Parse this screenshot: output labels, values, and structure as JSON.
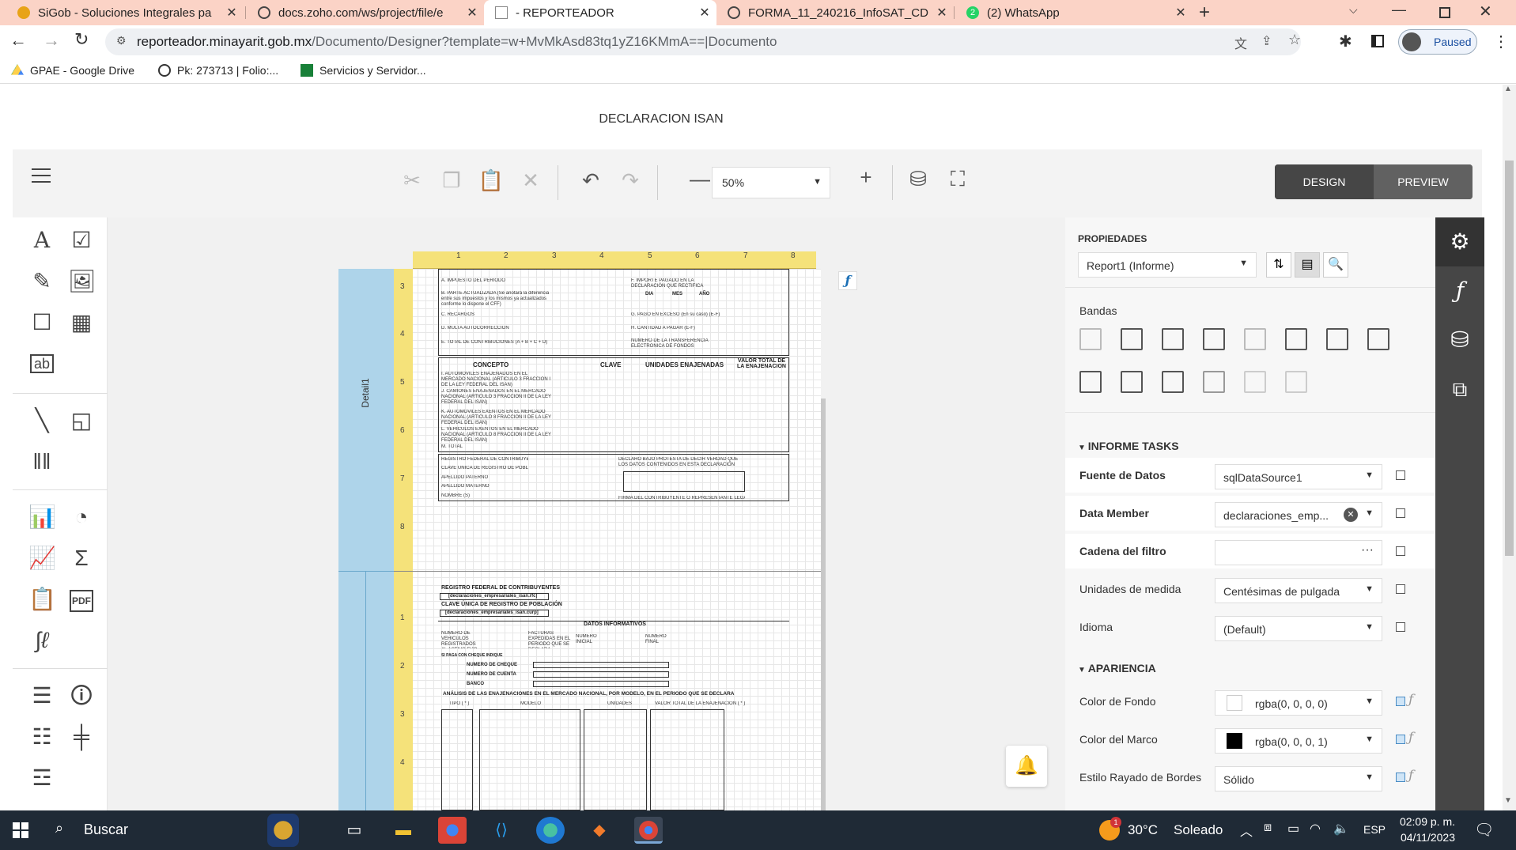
{
  "browser": {
    "tabs": [
      {
        "title": "SiGob - Soluciones Integrales pa",
        "active": false
      },
      {
        "title": "docs.zoho.com/ws/project/file/e",
        "active": false
      },
      {
        "title": "- REPORTEADOR",
        "active": true
      },
      {
        "title": "FORMA_11_240216_InfoSAT_CD",
        "active": false
      },
      {
        "title": "(2) WhatsApp",
        "active": false
      }
    ],
    "whatsapp_badge": "2",
    "url_host": "reporteador.minayarit.gob.mx",
    "url_path": "/Documento/Designer?template=w+MvMkAsd83tq1yZ16KMmA==|Documento",
    "profile_status": "Paused",
    "bookmarks": [
      {
        "label": "GPAE - Google Drive"
      },
      {
        "label": "Pk: 273713 | Folio:..."
      },
      {
        "label": "Servicios y Servidor..."
      }
    ]
  },
  "page": {
    "title": "DECLARACION ISAN"
  },
  "toolbar": {
    "zoom_value": "50%",
    "design_label": "DESIGN",
    "preview_label": "PREVIEW"
  },
  "canvas": {
    "band_label": "Detail1",
    "ruler_top": [
      "1",
      "2",
      "3",
      "4",
      "5",
      "6",
      "7",
      "8"
    ],
    "ruler_left_a": [
      "3",
      "4",
      "5",
      "6",
      "7",
      "8"
    ],
    "ruler_left_b": [
      "1",
      "2",
      "3",
      "4"
    ],
    "form_top_rows": [
      "A. IMPUESTO DEL PERIODO",
      "B. PARTE ACTUALIZADA (Se anotará la diferencia entre sus impuestos y los mismos ya actualizados conforme lo dispone el CFF)",
      "C. RECARGOS",
      "D. MULTA AUTOCORRECCION",
      "E. TOTAL DE CONTRIBUCIONES (A + B + C + D)"
    ],
    "form_top_right": [
      "F. IMPORTE PAGADO EN LA DECLARACIÓN QUE RECTIFICA",
      "G. PAGO EN EXCESO (En su caso) (E-F)",
      "H. CANTIDAD A PAGAR (E-F)",
      "NUMERO DE LA TRANSFERENCIA ELECTRONICA DE FONDOS"
    ],
    "dia_mes_ano": [
      "DIA",
      "MES",
      "AÑO"
    ],
    "field_placeholder": "[declaraciones_empresariales_isan...",
    "concept_headers": [
      "CONCEPTO",
      "CLAVE",
      "UNIDADES ENAJENADAS",
      "VALOR TOTAL DE LA ENAJENACION"
    ],
    "concept_rows": [
      "I. AUTOMOVILES ENAJENADOS EN EL MERCADO NACIONAL (ARTICULO 3 FRACCION I DE LA LEY FEDERAL DEL ISAN)",
      "J. CAMIONES ENAJENADOS EN EL MERCADO NACIONAL (ARTICULO 3 FRACCION II DE LA LEY FEDERAL DEL ISAN)",
      "K. AUTOMOVILES EXENTOS EN EL MERCADO NACIONAL (ARTICULO 8 FRACCION II DE LA LEY FEDERAL DEL ISAN)",
      "L. VEHICULOS EXENTOS EN EL MERCADO NACIONAL (ARTICULO 8 FRACCION II DE LA LEY FEDERAL DEL ISAN)",
      "M. TOTAL"
    ],
    "taxpayer_rows": [
      "REGISTRO FEDERAL DE CONTRIBUYENTES",
      "CLAVE UNICA DE REGISTRO DE POBLACIÓN",
      "APELLIDO PATERNO",
      "APELLIDO MATERNO",
      "NOMBRE (S)"
    ],
    "declaration_text": "DECLARO BAJO PROTESTA DE DECIR VERDAD QUE LOS DATOS CONTENIDOS EN ESTA DECLARACIÓN SON CIERTOS",
    "signature_label": "FIRMA DEL CONTRIBUYENTE O REPRESENTANTE LEGAL",
    "rfc_header": "REGISTRO FEDERAL DE CONTRIBUYENTES",
    "rfc_field": "[declaraciones_empresariales_isan.rfc]",
    "curp_header": "CLAVE ÚNICA DE REGISTRO DE POBLACIÓN",
    "curp_field": "[declaraciones_empresariales_isan.curp]",
    "datos_header": "DATOS INFORMATIVOS",
    "datos_labels": [
      "NUMERO DE VEHICULOS REGISTRADOS AL ACTIVO FIJO",
      "FACTURAS EXPEDIDAS EN EL PERIODO QUE SE DECLARA",
      "NUMERO INICIAL",
      "NUMERO FINAL"
    ],
    "cheque_note": "SI PAGA CON CHEQUE INDIQUE",
    "cheque_rows": [
      "NUMERO DE CHEQUE",
      "NUMERO DE CUENTA",
      "BANCO"
    ],
    "analysis_header": "ANÁLISIS DE LAS ENAJENACIONES EN EL MERCADO NACIONAL, POR MODELO, EN EL PERIODO QUE SE DECLARA",
    "analysis_cols": [
      "TIPO ( * )",
      "MODELO",
      "UNIDADES",
      "VALOR TOTAL DE LA ENAJENACIÓN ( * )"
    ]
  },
  "properties": {
    "title": "PROPIEDADES",
    "object": "Report1 (Informe)",
    "bandas_label": "Bandas",
    "tasks_header": "INFORME TASKS",
    "rows": [
      {
        "label": "Fuente de Datos",
        "value": "sqlDataSource1",
        "bold": true
      },
      {
        "label": "Data Member",
        "value": "declaraciones_emp...",
        "bold": true
      },
      {
        "label": "Cadena del filtro",
        "value": "",
        "bold": true
      },
      {
        "label": "Unidades de medida",
        "value": "Centésimas de pulgada",
        "bold": false
      },
      {
        "label": "Idioma",
        "value": "(Default)",
        "bold": false
      }
    ],
    "appearance_header": "APARIENCIA",
    "appearance_rows": [
      {
        "label": "Color de Fondo",
        "value": "rgba(0, 0, 0, 0)",
        "swatch": "#ffffff"
      },
      {
        "label": "Color del Marco",
        "value": "rgba(0, 0, 0, 1)",
        "swatch": "#000000"
      },
      {
        "label": "Estilo Rayado de Bordes",
        "value": "Sólido",
        "swatch": ""
      }
    ]
  },
  "taskbar": {
    "search_label": "Buscar",
    "weather_temp": "30°C",
    "weather_desc": "Soleado",
    "language": "ESP",
    "time": "02:09 p. m.",
    "date": "04/11/2023",
    "notification_badge": "1"
  },
  "colors": {
    "tabbar_bg": "#fbd3c6",
    "design_active_bg": "#464646",
    "band_blue": "#aed4ea",
    "ruler_yellow": "#f5e27a",
    "taskbar_bg": "#1f2a36"
  }
}
